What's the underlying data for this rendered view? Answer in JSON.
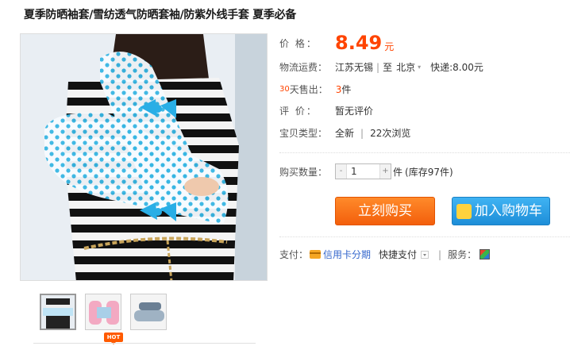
{
  "title": "夏季防晒袖套/雪纺透气防晒套袖/防紫外线手套 夏季必备",
  "price": {
    "label": "价    格：",
    "value": "8.49",
    "unit": "元"
  },
  "shipping": {
    "label": "物流运费：",
    "from": "江苏无锡",
    "divider": "|",
    "to_prefix": "至",
    "to": "北京",
    "express_label": "快递:",
    "express_value": "8.00元"
  },
  "sales": {
    "days": "30",
    "label": "天售出：",
    "count": "3",
    "count_unit": "件"
  },
  "rating": {
    "label": "评    价：",
    "value": "暂无评价"
  },
  "item_type": {
    "label": "宝贝类型：",
    "condition": "全新",
    "divider": "|",
    "views": "22次浏览"
  },
  "quantity": {
    "label": "购买数量：",
    "minus": "-",
    "value": "1",
    "plus": "+",
    "unit": "件",
    "stock": "(库存97件)"
  },
  "buttons": {
    "buy_now": "立刻购买",
    "add_to_cart": "加入购物车"
  },
  "payment": {
    "label": "支付：",
    "card_option": "信用卡分期",
    "quick_pay": "快捷支付"
  },
  "service": {
    "label": "服务："
  },
  "thumbnails": {
    "hot_badge": "HOT"
  },
  "colors": {
    "accent": "#ff4400",
    "buy": "#f47a1f",
    "cart": "#2b9fe6",
    "polka": "#38b6e3"
  }
}
